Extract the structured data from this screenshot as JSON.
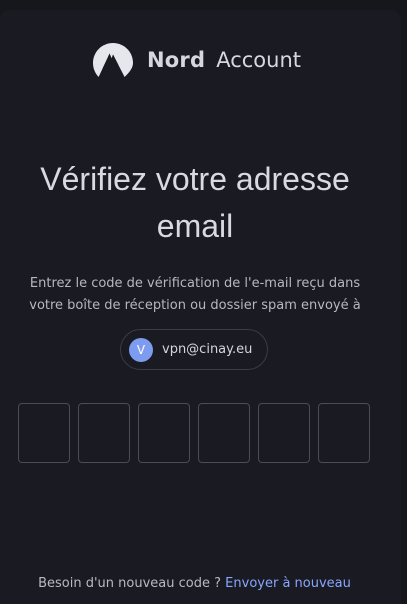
{
  "brand": {
    "name_bold": "Nord",
    "name_light": "Account",
    "logo_icon": "mountain-logo-icon"
  },
  "title": {
    "line1": "Vérifiez votre adresse",
    "line2": "email"
  },
  "subtitle": {
    "line1": "Entrez le code de vérification de l'e-mail reçu dans",
    "line2": "votre boîte de réception ou dossier spam envoyé à"
  },
  "recipient": {
    "avatar_letter": "V",
    "email": "vpn@cinay.eu"
  },
  "code_inputs": [
    {
      "value": ""
    },
    {
      "value": ""
    },
    {
      "value": ""
    },
    {
      "value": ""
    },
    {
      "value": ""
    },
    {
      "value": ""
    }
  ],
  "resend": {
    "prompt": "Besoin d'un nouveau code ?",
    "link_label": "Envoyer à nouveau"
  },
  "colors": {
    "background": "#16171d",
    "card": "#191a22",
    "text": "#d8dae0",
    "muted_text": "#b6b8c0",
    "link": "#8aa6ff",
    "avatar": "#7d9cf0",
    "input_border": "#4a4c56"
  }
}
